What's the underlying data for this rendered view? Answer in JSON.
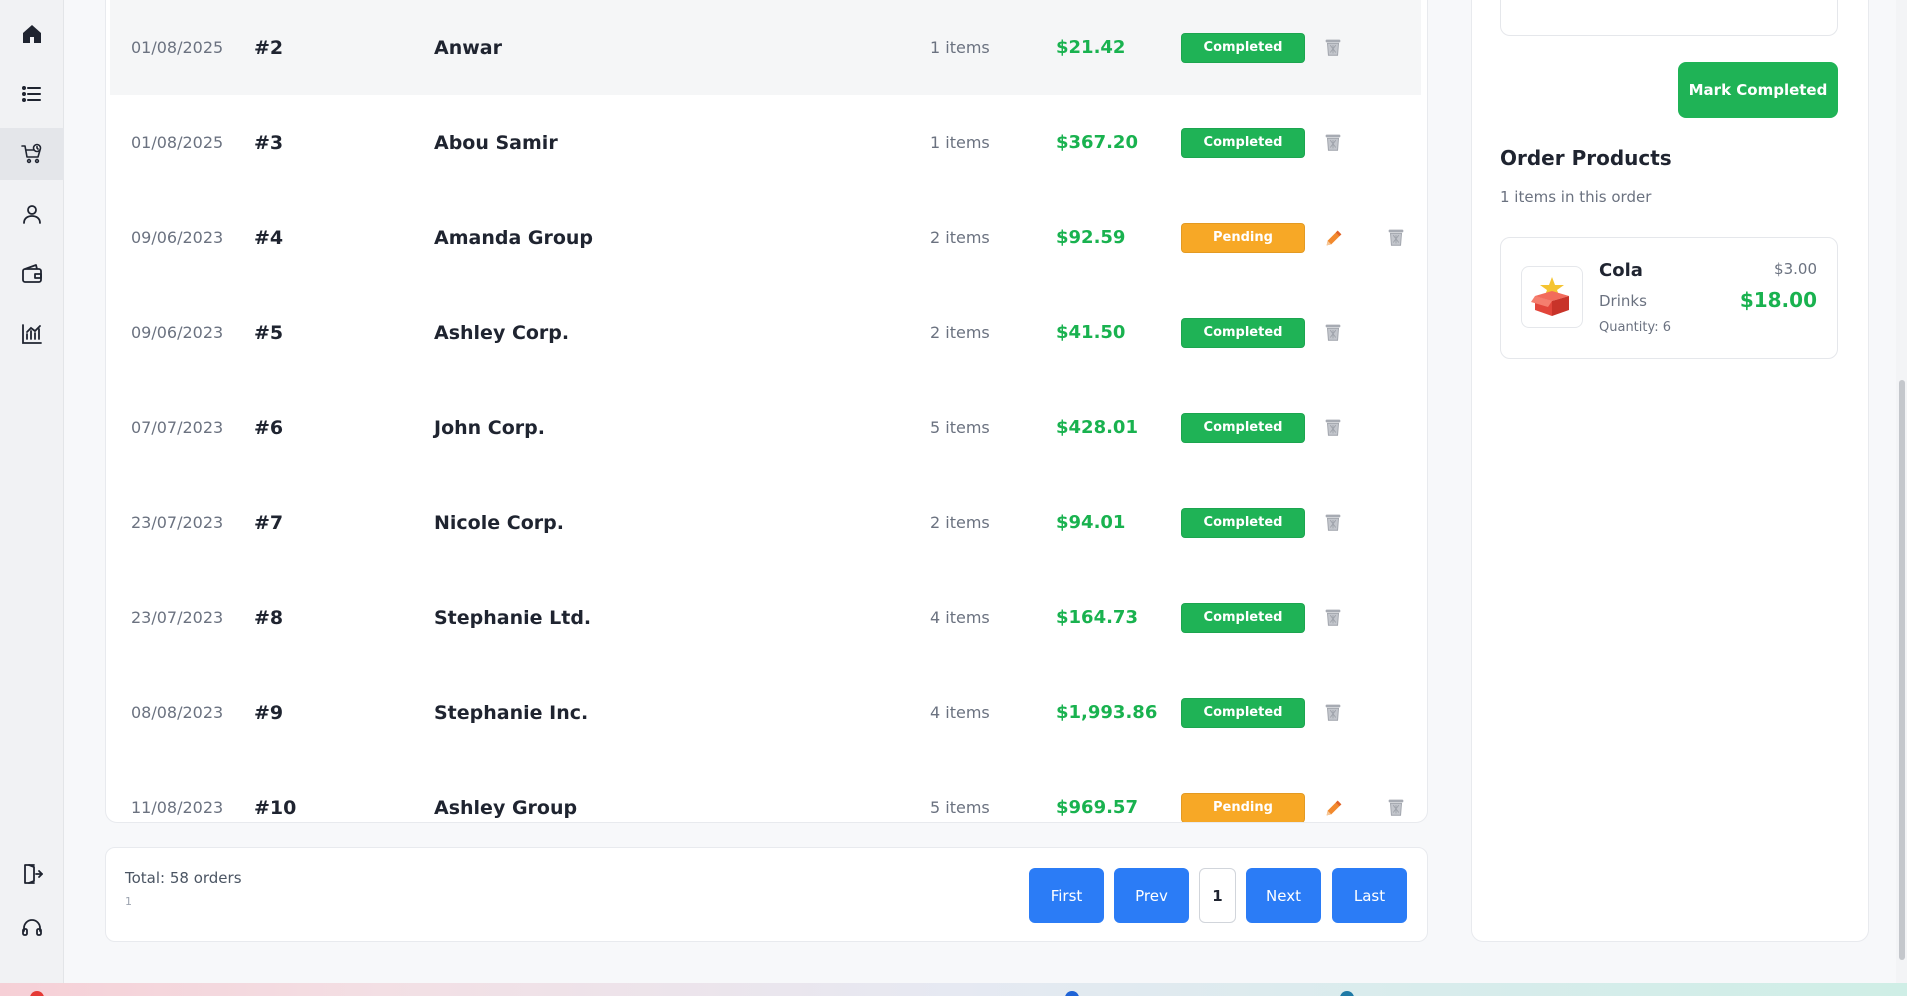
{
  "sidebar": {
    "items": [
      {
        "name": "home-icon"
      },
      {
        "name": "list-icon"
      },
      {
        "name": "cart-clock-icon",
        "active": true
      },
      {
        "name": "user-icon"
      },
      {
        "name": "wallet-icon"
      },
      {
        "name": "chart-icon"
      }
    ],
    "bottom_items": [
      {
        "name": "logout-icon"
      },
      {
        "name": "headset-icon"
      }
    ]
  },
  "orders": [
    {
      "date": "01/08/2025",
      "id": "#2",
      "customer": "Anwar",
      "items": "1 items",
      "total": "$21.42",
      "status": "Completed",
      "editable": false
    },
    {
      "date": "01/08/2025",
      "id": "#3",
      "customer": "Abou Samir",
      "items": "1 items",
      "total": "$367.20",
      "status": "Completed",
      "editable": false
    },
    {
      "date": "09/06/2023",
      "id": "#4",
      "customer": "Amanda Group",
      "items": "2 items",
      "total": "$92.59",
      "status": "Pending",
      "editable": true
    },
    {
      "date": "09/06/2023",
      "id": "#5",
      "customer": "Ashley Corp.",
      "items": "2 items",
      "total": "$41.50",
      "status": "Completed",
      "editable": false
    },
    {
      "date": "07/07/2023",
      "id": "#6",
      "customer": "John Corp.",
      "items": "5 items",
      "total": "$428.01",
      "status": "Completed",
      "editable": false
    },
    {
      "date": "23/07/2023",
      "id": "#7",
      "customer": "Nicole Corp.",
      "items": "2 items",
      "total": "$94.01",
      "status": "Completed",
      "editable": false
    },
    {
      "date": "23/07/2023",
      "id": "#8",
      "customer": "Stephanie Ltd.",
      "items": "4 items",
      "total": "$164.73",
      "status": "Completed",
      "editable": false
    },
    {
      "date": "08/08/2023",
      "id": "#9",
      "customer": "Stephanie Inc.",
      "items": "4 items",
      "total": "$1,993.86",
      "status": "Completed",
      "editable": false
    },
    {
      "date": "11/08/2023",
      "id": "#10",
      "customer": "Ashley Group",
      "items": "5 items",
      "total": "$969.57",
      "status": "Pending",
      "editable": true
    }
  ],
  "pagination": {
    "total_label": "Total: 58 orders",
    "sub_label": "1",
    "first": "First",
    "prev": "Prev",
    "current": "1",
    "next": "Next",
    "last": "Last"
  },
  "detail": {
    "mark_completed": "Mark Completed",
    "title": "Order Products",
    "subtitle": "1 items in this order",
    "products": [
      {
        "name": "Cola",
        "category": "Drinks",
        "quantity": "Quantity: 6",
        "unit_price": "$3.00",
        "line_total": "$18.00",
        "icon": "product-box-icon"
      }
    ]
  },
  "colors": {
    "completed": "#1fb356",
    "pending": "#f7a826",
    "money": "#19b24f",
    "primary": "#2b7cf6"
  }
}
